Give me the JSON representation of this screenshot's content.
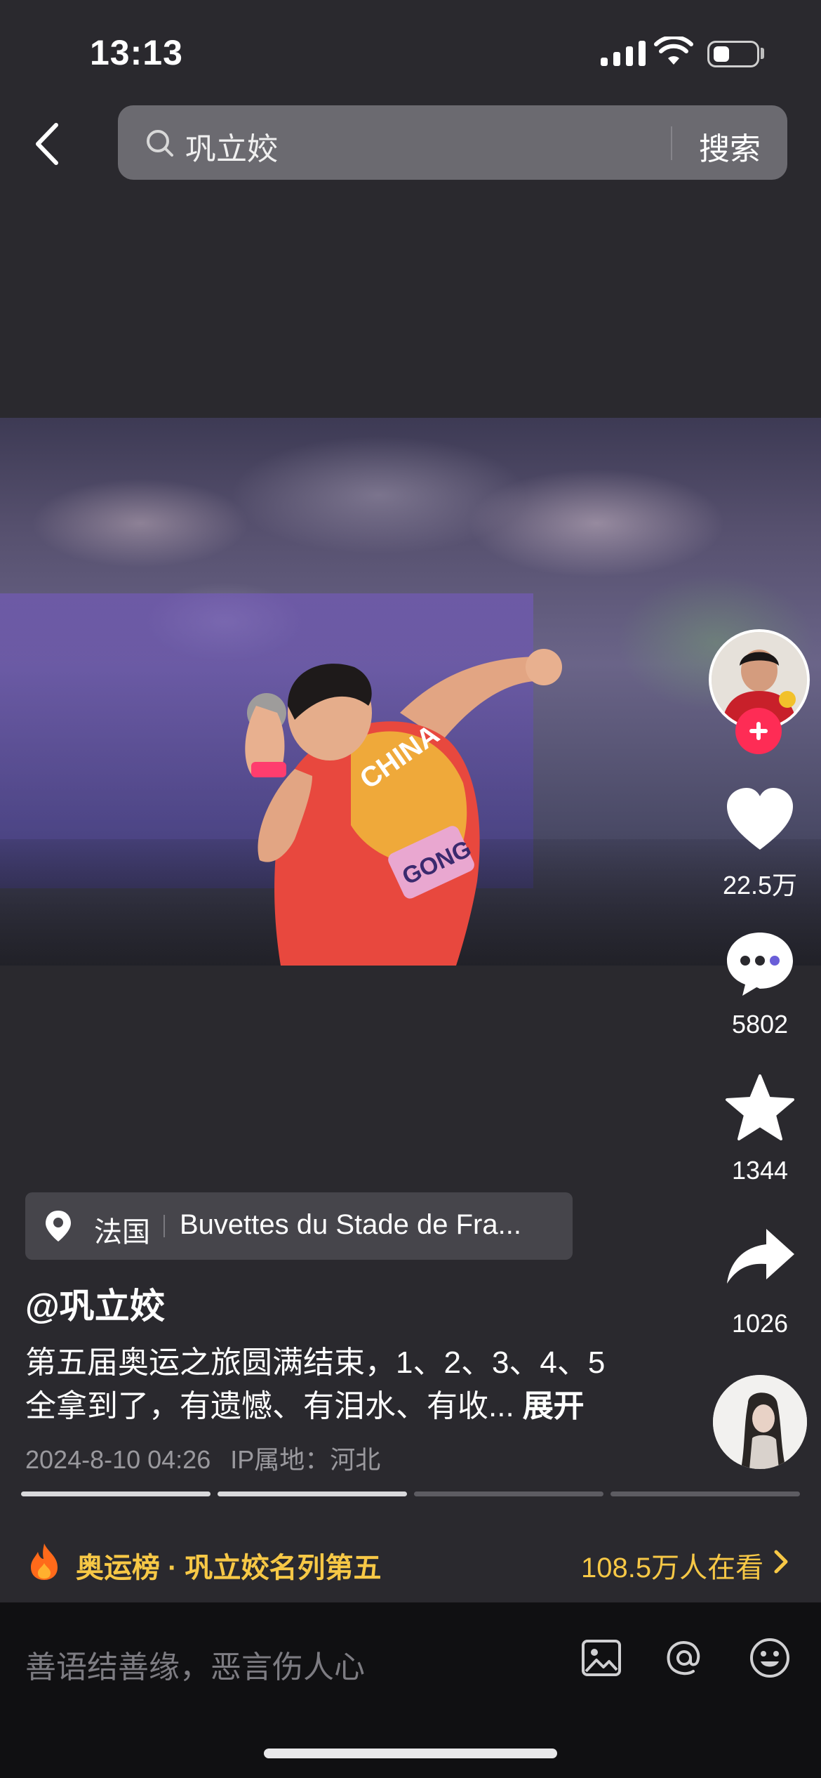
{
  "status_bar": {
    "time": "13:13"
  },
  "search": {
    "query": "巩立姣",
    "button": "搜索"
  },
  "video": {
    "description_alt": ""
  },
  "rail": {
    "likes": "22.5万",
    "comments": "5802",
    "favorites": "1344",
    "shares": "1026"
  },
  "location": {
    "country": "法国",
    "place": "Buvettes du Stade de Fra..."
  },
  "post": {
    "author": "@巩立姣",
    "text_line1": "第五届奥运之旅圆满结束，1、2、3、4、5",
    "text_line2": "全拿到了，有遗憾、有泪水、有收...",
    "expand": "展开",
    "date": "2024-8-10 04:26",
    "ip": "IP属地：河北"
  },
  "progress": {
    "segments": 4,
    "completed": 2
  },
  "ranking": {
    "label": "奥运榜 · 巩立姣名列第五",
    "viewers": "108.5万人在看"
  },
  "comment": {
    "placeholder": "善语结善缘，恶言伤人心"
  },
  "colors": {
    "accent_red": "#fe2c55",
    "ranking_yellow": "#f7c846"
  }
}
